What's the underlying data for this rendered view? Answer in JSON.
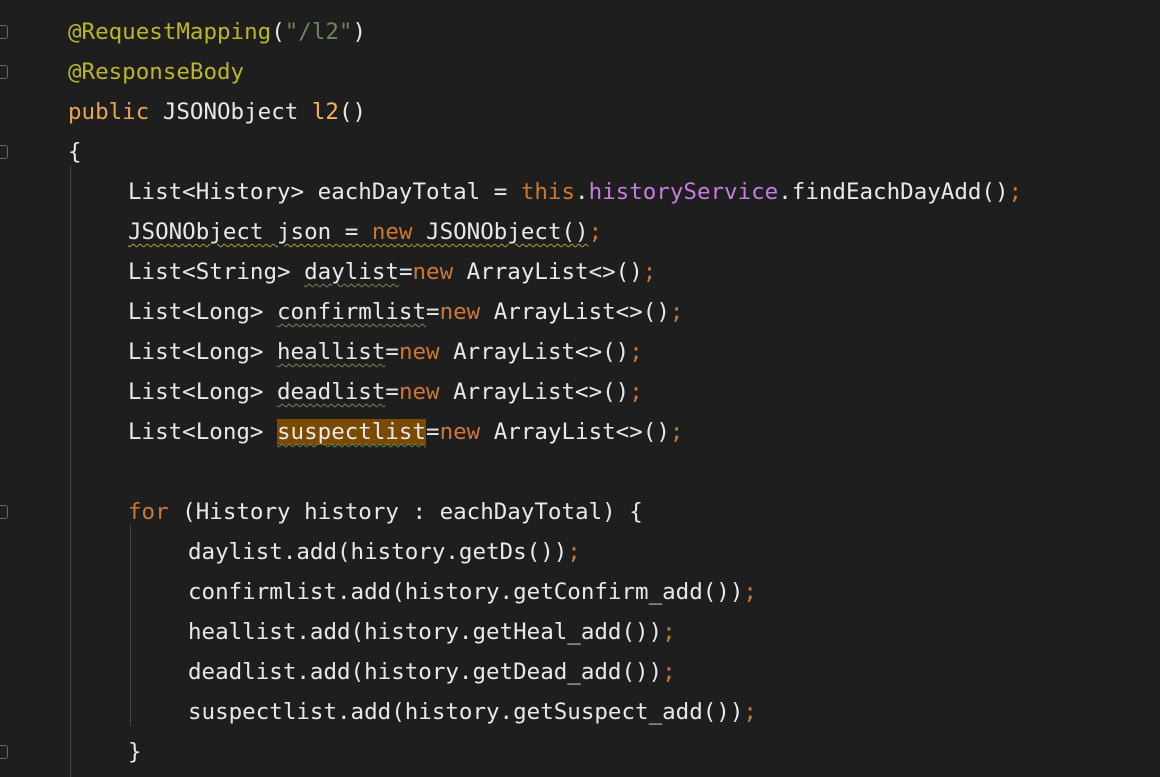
{
  "editor": {
    "lines": [
      {
        "indent": 0,
        "tokens": [
          {
            "t": "@RequestMapping",
            "c": "ann"
          },
          {
            "t": "(",
            "c": "plain"
          },
          {
            "t": "\"/l2\"",
            "c": "str"
          },
          {
            "t": ")",
            "c": "plain"
          }
        ]
      },
      {
        "indent": 0,
        "tokens": [
          {
            "t": "@ResponseBody",
            "c": "ann"
          }
        ]
      },
      {
        "indent": 0,
        "tokens": [
          {
            "t": "public",
            "c": "kwp"
          },
          {
            "t": " JSONObject ",
            "c": "plain"
          },
          {
            "t": "l2",
            "c": "fn"
          },
          {
            "t": "()",
            "c": "plain"
          }
        ]
      },
      {
        "indent": 0,
        "tokens": [
          {
            "t": "{",
            "c": "plain"
          }
        ]
      },
      {
        "indent": 1,
        "tokens": [
          {
            "t": "List<History> eachDayTotal = ",
            "c": "plain"
          },
          {
            "t": "this",
            "c": "kw"
          },
          {
            "t": ".",
            "c": "plain"
          },
          {
            "t": "historyService",
            "c": "fld"
          },
          {
            "t": ".findEachDayAdd()",
            "c": "plain"
          },
          {
            "t": ";",
            "c": "semi"
          }
        ]
      },
      {
        "indent": 1,
        "tokens": [
          {
            "t": "JSONObject json = ",
            "c": "plain",
            "u": "squig-y"
          },
          {
            "t": "new",
            "c": "kw",
            "u": "squig-y"
          },
          {
            "t": " JSONObject()",
            "c": "plain",
            "u": "squig-y"
          },
          {
            "t": ";",
            "c": "semi"
          }
        ]
      },
      {
        "indent": 1,
        "tokens": [
          {
            "t": "List<String> ",
            "c": "plain"
          },
          {
            "t": "daylist",
            "c": "plain",
            "u": "squig"
          },
          {
            "t": "=",
            "c": "plain"
          },
          {
            "t": "new",
            "c": "kw"
          },
          {
            "t": " ArrayList<>()",
            "c": "plain"
          },
          {
            "t": ";",
            "c": "semi"
          }
        ]
      },
      {
        "indent": 1,
        "tokens": [
          {
            "t": "List<Long> ",
            "c": "plain"
          },
          {
            "t": "confirmlist",
            "c": "plain",
            "u": "squig"
          },
          {
            "t": "=",
            "c": "plain"
          },
          {
            "t": "new",
            "c": "kw"
          },
          {
            "t": " ArrayList<>()",
            "c": "plain"
          },
          {
            "t": ";",
            "c": "semi"
          }
        ]
      },
      {
        "indent": 1,
        "tokens": [
          {
            "t": "List<Long> ",
            "c": "plain"
          },
          {
            "t": "heallist",
            "c": "plain",
            "u": "squig"
          },
          {
            "t": "=",
            "c": "plain"
          },
          {
            "t": "new",
            "c": "kw"
          },
          {
            "t": " ArrayList<>()",
            "c": "plain"
          },
          {
            "t": ";",
            "c": "semi"
          }
        ]
      },
      {
        "indent": 1,
        "tokens": [
          {
            "t": "List<Long> ",
            "c": "plain"
          },
          {
            "t": "deadlist",
            "c": "plain",
            "u": "squig"
          },
          {
            "t": "=",
            "c": "plain"
          },
          {
            "t": "new",
            "c": "kw"
          },
          {
            "t": " ArrayList<>()",
            "c": "plain"
          },
          {
            "t": ";",
            "c": "semi"
          }
        ]
      },
      {
        "indent": 1,
        "tokens": [
          {
            "t": "List<Long> ",
            "c": "plain"
          },
          {
            "t": "suspectlist",
            "c": "plain",
            "u": "squig",
            "hl": true
          },
          {
            "t": "=",
            "c": "plain"
          },
          {
            "t": "new",
            "c": "kw"
          },
          {
            "t": " ArrayList<>()",
            "c": "plain"
          },
          {
            "t": ";",
            "c": "semi"
          }
        ]
      },
      {
        "indent": 1,
        "tokens": []
      },
      {
        "indent": 1,
        "tokens": [
          {
            "t": "for",
            "c": "kw"
          },
          {
            "t": " (History history : eachDayTotal) {",
            "c": "plain"
          }
        ]
      },
      {
        "indent": 2,
        "tokens": [
          {
            "t": "daylist.add(history.getDs())",
            "c": "plain"
          },
          {
            "t": ";",
            "c": "semi"
          }
        ]
      },
      {
        "indent": 2,
        "tokens": [
          {
            "t": "confirmlist.add(history.getConfirm_add())",
            "c": "plain"
          },
          {
            "t": ";",
            "c": "semi"
          }
        ]
      },
      {
        "indent": 2,
        "tokens": [
          {
            "t": "heallist.add(history.getHeal_add())",
            "c": "plain"
          },
          {
            "t": ";",
            "c": "semi"
          }
        ]
      },
      {
        "indent": 2,
        "tokens": [
          {
            "t": "deadlist.add(history.getDead_add())",
            "c": "plain"
          },
          {
            "t": ";",
            "c": "semi"
          }
        ]
      },
      {
        "indent": 2,
        "tokens": [
          {
            "t": "suspectlist.add(history.getSuspect_add())",
            "c": "plain"
          },
          {
            "t": ";",
            "c": "semi"
          }
        ]
      },
      {
        "indent": 1,
        "tokens": [
          {
            "t": "}",
            "c": "plain"
          }
        ]
      }
    ],
    "fold_markers": [
      0,
      1,
      3,
      12,
      18
    ],
    "colors": {
      "background": "#1e1e1e",
      "annotation": "#bbb529",
      "string": "#6a8759",
      "keyword": "#cc7832",
      "field": "#c77dde",
      "method_decl": "#f0b65a",
      "highlight": "#7a4a00"
    }
  }
}
